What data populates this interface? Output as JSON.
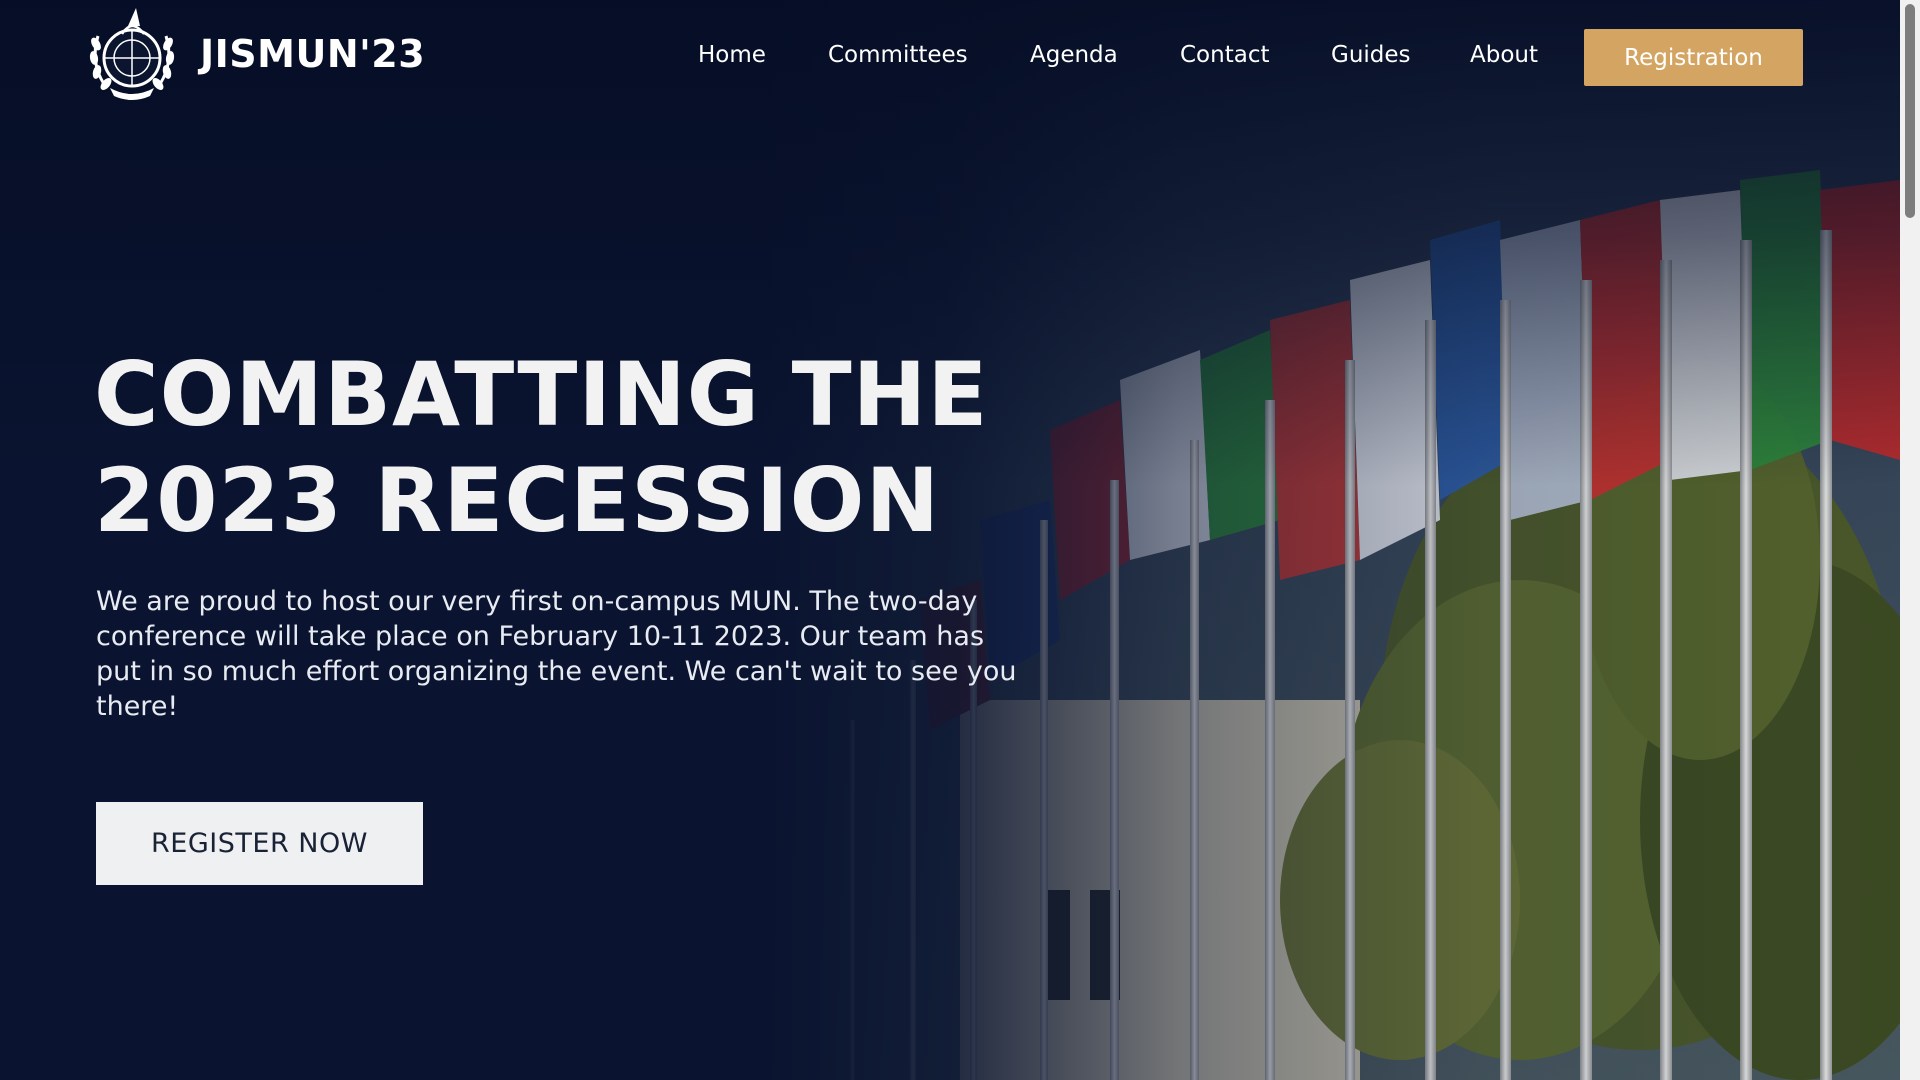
{
  "header": {
    "brand": "JISMUN'23",
    "nav": [
      {
        "label": "Home"
      },
      {
        "label": "Committees"
      },
      {
        "label": "Agenda"
      },
      {
        "label": "Contact"
      },
      {
        "label": "Guides"
      },
      {
        "label": "About"
      }
    ],
    "cta_label": "Registration"
  },
  "hero": {
    "title_line1": "COMBATTING THE",
    "title_line2": "2023 RECESSION",
    "description": "We are proud to host our very first on-campus MUN. The two-day conference will take place on February 10-11 2023. Our team has put in so much effort organizing the event. We can't wait to see you there!",
    "button_label": "REGISTER NOW"
  },
  "colors": {
    "background": "#0b1530",
    "accent": "#d4a562",
    "button_light": "#eff0f2",
    "text": "#ffffff"
  },
  "icons": {
    "logo": "un-emblem-logo"
  }
}
